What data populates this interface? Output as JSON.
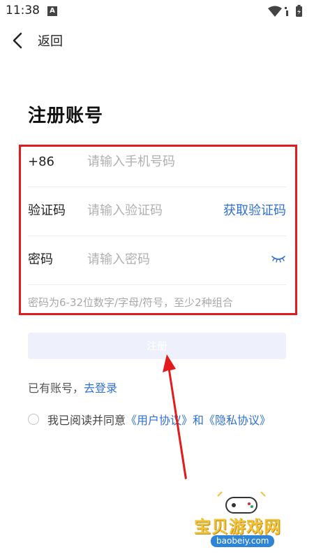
{
  "status_bar": {
    "time": "11:38",
    "notif_icon_letter": "A"
  },
  "header": {
    "back_label": "返回"
  },
  "page": {
    "title": "注册账号"
  },
  "form": {
    "phone": {
      "prefix": "+86",
      "placeholder": "请输入手机号码"
    },
    "code": {
      "label": "验证码",
      "placeholder": "请输入验证码",
      "get_code_label": "获取验证码"
    },
    "password": {
      "label": "密码",
      "placeholder": "请输入密码",
      "hint": "密码为6-32位数字/字母/符号，至少2种组合"
    }
  },
  "register_button": {
    "label": "注册"
  },
  "login_prompt": {
    "text": "已有账号，",
    "link": "去登录"
  },
  "agreement": {
    "prefix": "我已阅读并同意",
    "user_agreement": "《用户协议》",
    "and": "和",
    "privacy_agreement": "《隐私协议》"
  },
  "watermark": {
    "title": "宝贝游戏网",
    "url": "baobeiy.com"
  },
  "colors": {
    "accent": "#2f6fd6",
    "highlight": "#e21c1c",
    "button_bg": "#eef1fb",
    "placeholder": "#b0b0b0"
  }
}
